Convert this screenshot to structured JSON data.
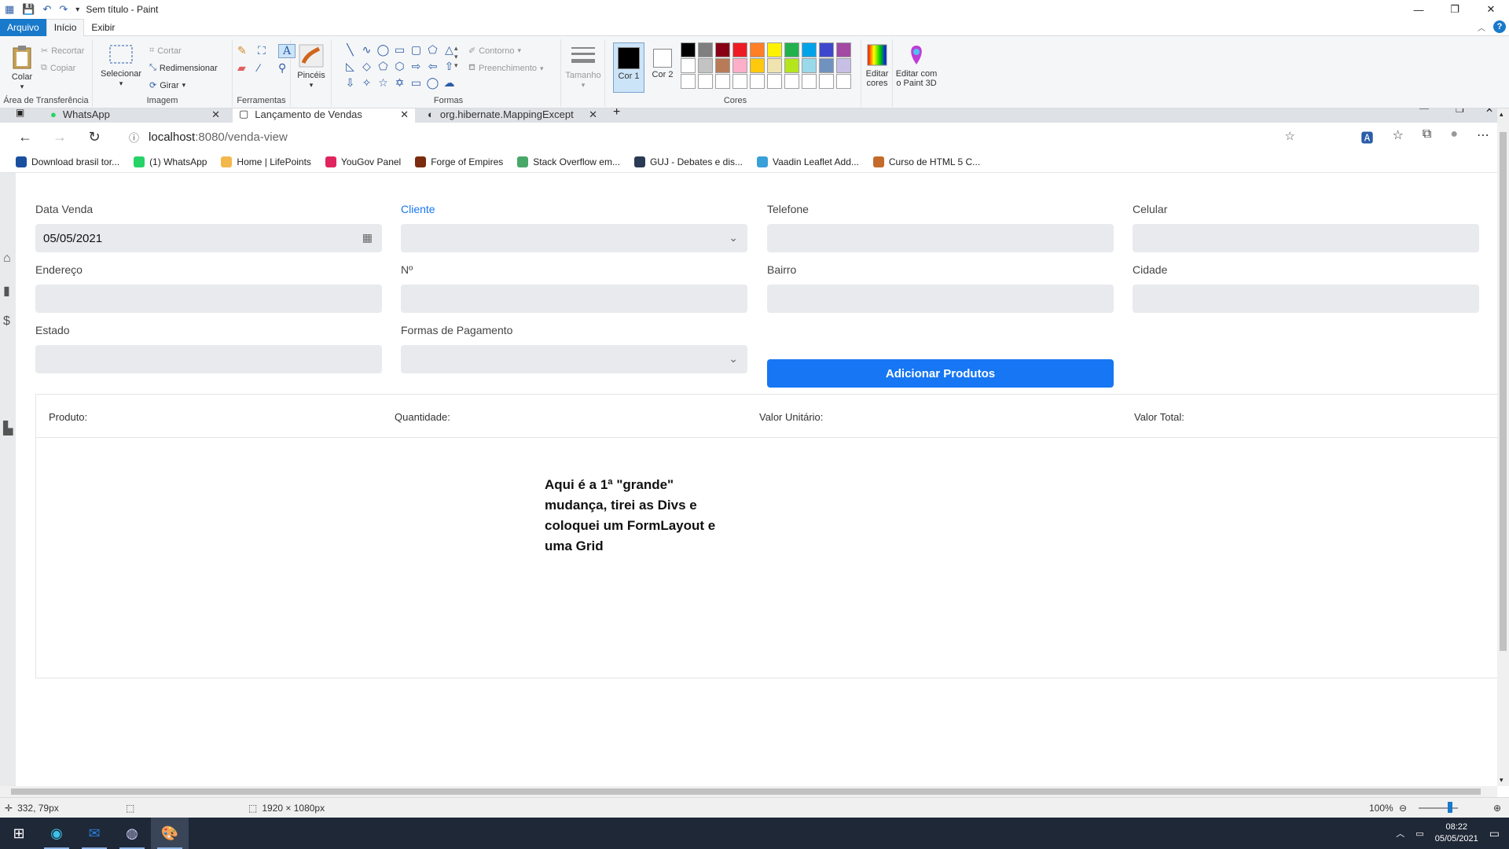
{
  "paint": {
    "title": "Sem título - Paint",
    "menu_tabs": [
      "Arquivo",
      "Início",
      "Exibir"
    ],
    "groups": {
      "clipboard": {
        "label": "Área de Transferência",
        "paste": "Colar",
        "cut": "Recortar",
        "copy": "Copiar"
      },
      "image": {
        "label": "Imagem",
        "select": "Selecionar",
        "crop": "Cortar",
        "resize": "Redimensionar",
        "rotate": "Girar"
      },
      "tools": {
        "label": "Ferramentas"
      },
      "brushes": {
        "label": "Pincéis"
      },
      "shapes": {
        "label": "Formas",
        "outline": "Contorno",
        "fill": "Preenchimento"
      },
      "size": {
        "label": "Tamanho"
      },
      "colors": {
        "label": "Cores",
        "color1": "Cor 1",
        "color2": "Cor 2",
        "edit": "Editar cores",
        "palette": [
          "#000000",
          "#7f7f7f",
          "#880015",
          "#ed1c24",
          "#ff7f27",
          "#fff200",
          "#22b14c",
          "#00a2e8",
          "#3f48cc",
          "#a349a4",
          "#ffffff",
          "#c3c3c3",
          "#b97a57",
          "#ffaec9",
          "#ffc90e",
          "#efe4b0",
          "#b5e61d",
          "#99d9ea",
          "#7092be",
          "#c8bfe7",
          "#ffffff",
          "#ffffff",
          "#ffffff",
          "#ffffff",
          "#ffffff",
          "#ffffff",
          "#ffffff",
          "#ffffff",
          "#ffffff",
          "#ffffff"
        ]
      },
      "paint3d": {
        "label": "Editar com o Paint 3D"
      }
    },
    "status": {
      "cursor": "332, 79px",
      "canvas_size": "1920 × 1080px",
      "zoom": "100%"
    }
  },
  "browser": {
    "tabs": [
      {
        "label": "WhatsApp"
      },
      {
        "label": "Lançamento de Vendas"
      },
      {
        "label": "org.hibernate.MappingException"
      }
    ],
    "url_host": "localhost",
    "url_path": ":8080/venda-view",
    "bookmarks": [
      {
        "label": "Download brasil tor...",
        "color": "#1a4fa0"
      },
      {
        "label": "(1) WhatsApp",
        "color": "#25d366"
      },
      {
        "label": "Home | LifePoints",
        "color": "#f2b84b"
      },
      {
        "label": "YouGov Panel",
        "color": "#e0245e"
      },
      {
        "label": "Forge of Empires",
        "color": "#7a2b10"
      },
      {
        "label": "Stack Overflow em...",
        "color": "#48a868"
      },
      {
        "label": "GUJ - Debates e dis...",
        "color": "#2b3a55"
      },
      {
        "label": "Vaadin Leaflet Add...",
        "color": "#3aa0d8"
      },
      {
        "label": "Curso de HTML 5 C...",
        "color": "#c46a2b"
      }
    ]
  },
  "form": {
    "data_venda": {
      "label": "Data Venda",
      "value": "05/05/2021"
    },
    "cliente": {
      "label": "Cliente",
      "value": ""
    },
    "telefone": {
      "label": "Telefone",
      "value": ""
    },
    "celular": {
      "label": "Celular",
      "value": ""
    },
    "endereco": {
      "label": "Endereço",
      "value": ""
    },
    "numero": {
      "label": "Nº",
      "value": ""
    },
    "bairro": {
      "label": "Bairro",
      "value": ""
    },
    "cidade": {
      "label": "Cidade",
      "value": ""
    },
    "estado": {
      "label": "Estado",
      "value": ""
    },
    "pagamento": {
      "label": "Formas de Pagamento",
      "value": ""
    },
    "add_button": "Adicionar Produtos"
  },
  "grid": {
    "columns": [
      "Produto:",
      "Quantidade:",
      "Valor Unitário:",
      "Valor Total:"
    ]
  },
  "note": "Aqui é a 1ª \"grande\" mudança, tirei as Divs e coloquei um FormLayout e uma Grid",
  "taskbar": {
    "time": "08:22",
    "date": "05/05/2021"
  }
}
